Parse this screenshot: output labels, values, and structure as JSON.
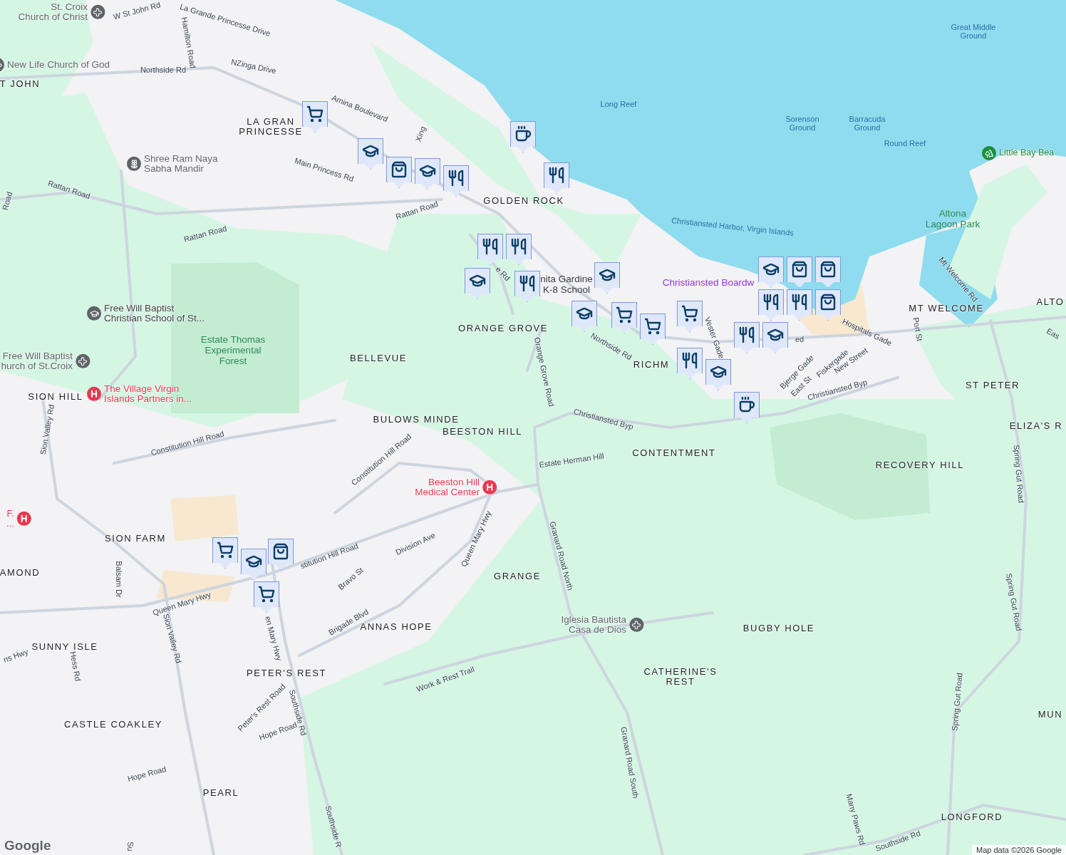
{
  "map": {
    "places": [
      {
        "text": "T JOHN"
      },
      {
        "text": "LA GRAN\nPRINCESSE"
      },
      {
        "text": "GOLDEN ROCK"
      },
      {
        "text": "ALTO"
      },
      {
        "text": "MT WELCOME"
      },
      {
        "text": "ORANGE GROVE"
      },
      {
        "text": "BELLEVUE"
      },
      {
        "text": "RICHM"
      },
      {
        "text": "ST PETER"
      },
      {
        "text": "SION HILL"
      },
      {
        "text": "BULOWS MINDE"
      },
      {
        "text": "ELIZA'S R"
      },
      {
        "text": "BEESTON HILL"
      },
      {
        "text": "CONTENTMENT"
      },
      {
        "text": "RECOVERY HILL"
      },
      {
        "text": "SION FARM"
      },
      {
        "text": "AMOND"
      },
      {
        "text": "GRANGE"
      },
      {
        "text": "ANNAS HOPE"
      },
      {
        "text": "BUGBY HOLE"
      },
      {
        "text": "SUNNY ISLE"
      },
      {
        "text": "PETER'S REST"
      },
      {
        "text": "CATHERINE'S\nREST"
      },
      {
        "text": "MUN"
      },
      {
        "text": "CASTLE COAKLEY"
      },
      {
        "text": "PEARL"
      },
      {
        "text": "LONGFORD"
      }
    ],
    "roads": [
      {
        "text": "W St John Rd"
      },
      {
        "text": "La Grande Princesse Drive"
      },
      {
        "text": "Hamilton Road"
      },
      {
        "text": "Northside Rd"
      },
      {
        "text": "NZinga Drive"
      },
      {
        "text": "Amina Boulevard"
      },
      {
        "text": "Main Princess Rd"
      },
      {
        "text": "Xing"
      },
      {
        "text": "Rattan Road"
      },
      {
        "text": "Rattan Road"
      },
      {
        "text": "Rattan Road"
      },
      {
        "text": "Road"
      },
      {
        "text": "Northside Rd"
      },
      {
        "text": "e Rd"
      },
      {
        "text": "Orange Grove Road"
      },
      {
        "text": "Christiansted Byp"
      },
      {
        "text": "Christiansted Byp"
      },
      {
        "text": "Estate Herman Hill"
      },
      {
        "text": "Constitution Hill Road"
      },
      {
        "text": "Constitution Hill Road"
      },
      {
        "text": "stitution Hill Road"
      },
      {
        "text": "Sion Valley Rd"
      },
      {
        "text": "Granard Road North"
      },
      {
        "text": "Queen Mary Hwy"
      },
      {
        "text": "Division Ave"
      },
      {
        "text": "Bravo St"
      },
      {
        "text": "Brigade Blvd"
      },
      {
        "text": "Queen Mary Hwy"
      },
      {
        "text": "en Mary Hwy"
      },
      {
        "text": "Balsam Dr"
      },
      {
        "text": "Sion Valley Rd"
      },
      {
        "text": "ns Hwy"
      },
      {
        "text": "Hess Rd"
      },
      {
        "text": "Southside Rd"
      },
      {
        "text": "Peter's Rest Road"
      },
      {
        "text": "Hope Road"
      },
      {
        "text": "Hope Road"
      },
      {
        "text": "Work & Rest Trail"
      },
      {
        "text": "Granard Road South"
      },
      {
        "text": "Southside R"
      },
      {
        "text": "Su"
      },
      {
        "text": "Many Paws Rd"
      },
      {
        "text": "Southside Rd"
      },
      {
        "text": "Spring Gut Road"
      },
      {
        "text": "Spring Gut Road"
      },
      {
        "text": "Spring Gut Road"
      },
      {
        "text": "Hospitals Gade"
      },
      {
        "text": "Port St"
      },
      {
        "text": "Mt Welcome Rd"
      },
      {
        "text": "Vester Gade"
      },
      {
        "text": "Bjerge Gade"
      },
      {
        "text": "East St"
      },
      {
        "text": "Fiskergade"
      },
      {
        "text": "New Street"
      },
      {
        "text": "Eas"
      },
      {
        "text": "ed"
      }
    ],
    "water": [
      {
        "text": "Great Middle\nGround"
      },
      {
        "text": "Long Reef"
      },
      {
        "text": "Sorenson\nGround"
      },
      {
        "text": "Barracuda\nGround"
      },
      {
        "text": "Round Reef"
      },
      {
        "text": "Christiansted Harbor, Virgin Islands"
      }
    ],
    "pois": [
      {
        "text": "St. Croix\nChurch of Christ",
        "kind": "church"
      },
      {
        "text": "New Life Church of God",
        "kind": "church"
      },
      {
        "text": "Shree Ram Naya\nSabha Mandir",
        "kind": "temple"
      },
      {
        "text": "Free Will Baptist\nChristian School of St...",
        "kind": "school"
      },
      {
        "text": "Free Will Baptist\nhurch of St.Croix",
        "kind": "church"
      },
      {
        "text": "The Village Virgin\nIslands Partners in...",
        "kind": "hospital"
      },
      {
        "text": "Beeston Hill\nMedical Center",
        "kind": "hospital"
      },
      {
        "text": "Iglesia Bautista\nCasa de Dios",
        "kind": "church"
      },
      {
        "text": "F.\n...",
        "kind": "hospital"
      },
      {
        "text": "Little Bay Bea",
        "kind": "park"
      },
      {
        "text": "Christiansted Boardw",
        "kind": "attraction"
      },
      {
        "text": "Altona\nLagoon Park",
        "kind": "park_area"
      },
      {
        "text": "Estate Thomas\nExperimental\nForest",
        "kind": "park_area"
      },
      {
        "text": "nita Gardine\nK-8 School",
        "kind": "plain"
      }
    ],
    "pins": [
      {
        "kind": "cart"
      },
      {
        "kind": "school"
      },
      {
        "kind": "bag"
      },
      {
        "kind": "school"
      },
      {
        "kind": "food"
      },
      {
        "kind": "coffee"
      },
      {
        "kind": "food"
      },
      {
        "kind": "food"
      },
      {
        "kind": "food"
      },
      {
        "kind": "school"
      },
      {
        "kind": "food"
      },
      {
        "kind": "school"
      },
      {
        "kind": "school"
      },
      {
        "kind": "cart"
      },
      {
        "kind": "cart"
      },
      {
        "kind": "cart"
      },
      {
        "kind": "school"
      },
      {
        "kind": "bag"
      },
      {
        "kind": "bag"
      },
      {
        "kind": "food"
      },
      {
        "kind": "food"
      },
      {
        "kind": "bag"
      },
      {
        "kind": "food"
      },
      {
        "kind": "school"
      },
      {
        "kind": "food"
      },
      {
        "kind": "school"
      },
      {
        "kind": "coffee"
      },
      {
        "kind": "cart"
      },
      {
        "kind": "school"
      },
      {
        "kind": "bag"
      },
      {
        "kind": "cart"
      }
    ],
    "logo": "Google",
    "attribution": "Map data ©2026 Google"
  }
}
